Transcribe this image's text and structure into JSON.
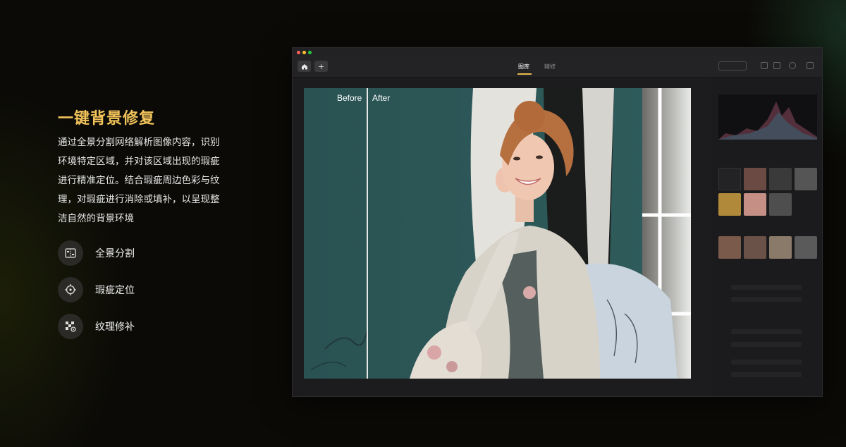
{
  "hero": {
    "title": "一键背景修复",
    "description": "通过全景分割网络解析图像内容，识别环境特定区域，并对该区域出现的瑕疵进行精准定位。结合瑕疵周边色彩与纹理，对瑕疵进行消除或填补，以呈现整洁自然的背景环境"
  },
  "features": [
    {
      "label": "全景分割",
      "icon": "panoptic-segmentation-icon"
    },
    {
      "label": "瑕疵定位",
      "icon": "crosshair-icon"
    },
    {
      "label": "纹理修补",
      "icon": "texture-patch-icon"
    }
  ],
  "app": {
    "tabs": [
      {
        "label": "图库",
        "active": true
      },
      {
        "label": "精修",
        "active": false
      }
    ],
    "canvas": {
      "before_label": "Before",
      "after_label": "After"
    }
  },
  "colors": {
    "accent": "#f1c35a",
    "background": "#0b0a07",
    "window": "#1c1c1e",
    "photo_wall": "#2e5a5b"
  }
}
